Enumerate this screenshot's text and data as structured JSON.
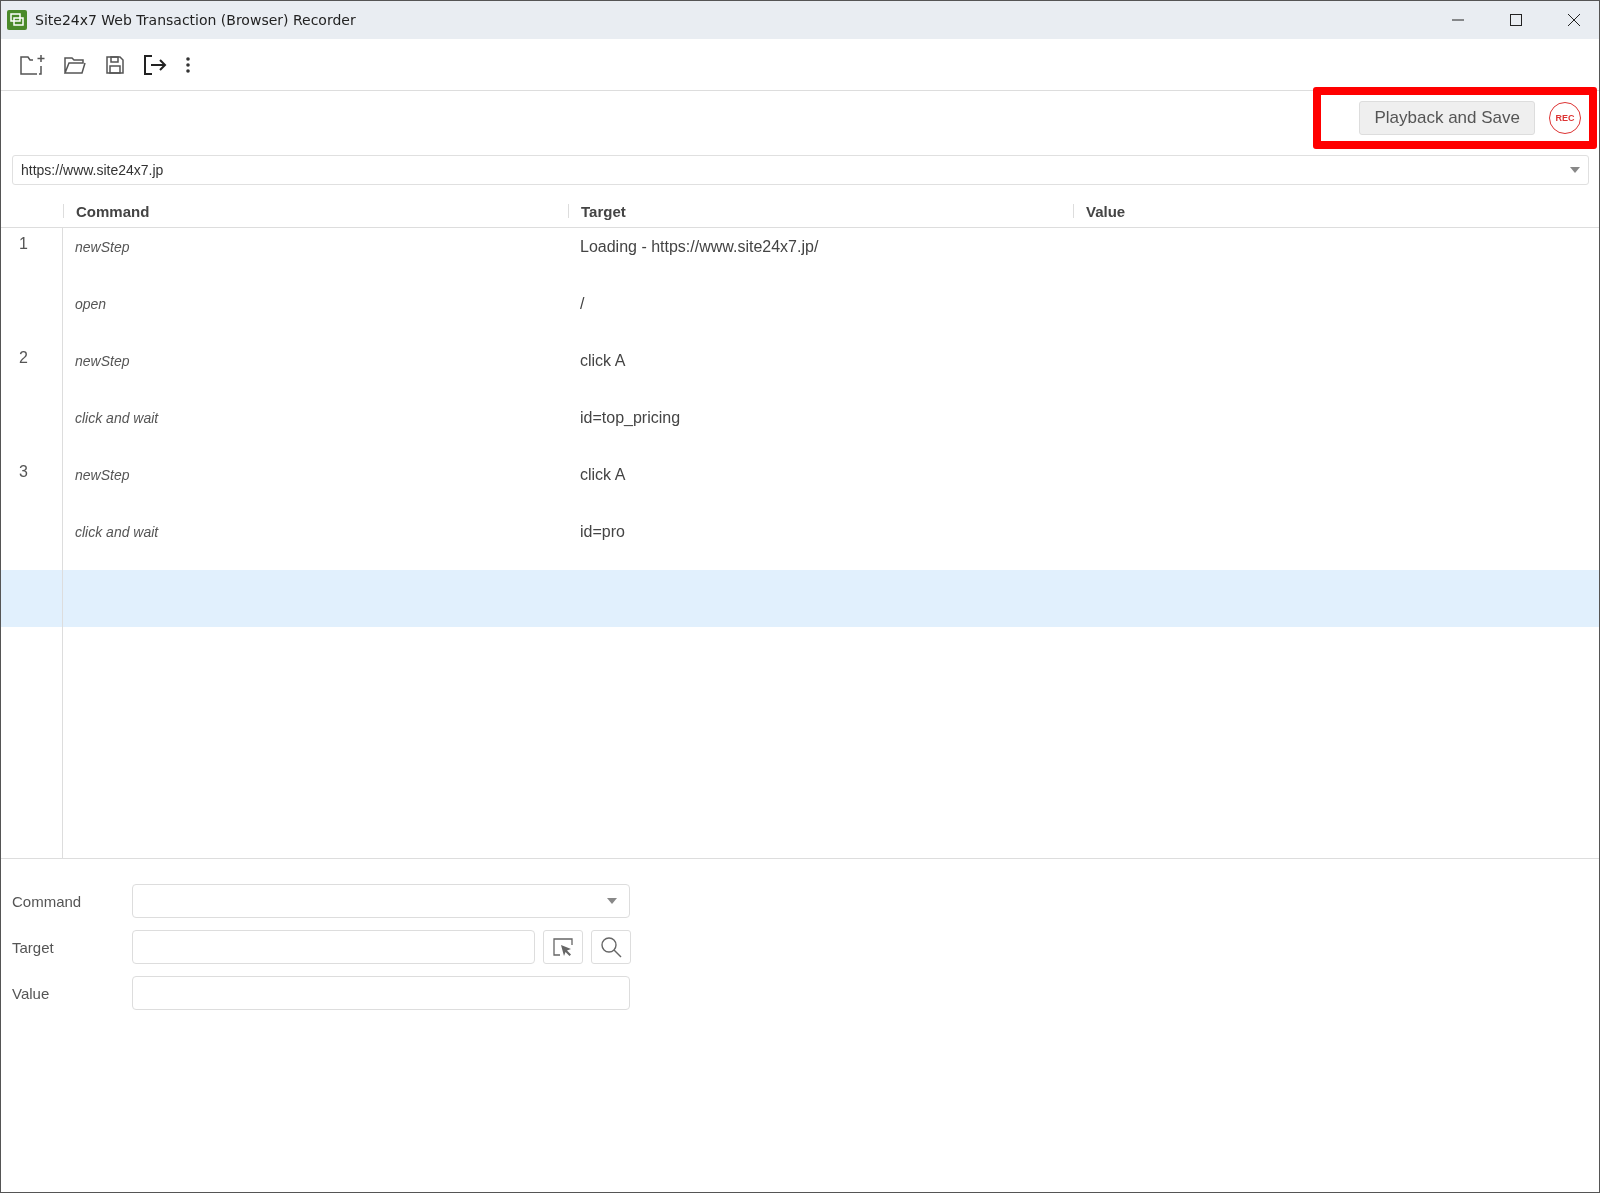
{
  "window": {
    "title": "Site24x7 Web Transaction (Browser) Recorder"
  },
  "actions": {
    "playback_button": "Playback and Save",
    "record_button": "REC",
    "annotation": {
      "kind": "frame"
    }
  },
  "url_field": {
    "value": "https://www.site24x7.jp"
  },
  "table": {
    "columns": [
      "Command",
      "Target",
      "Value"
    ],
    "steps": [
      {
        "number": "1",
        "commands": [
          {
            "command": "newStep",
            "target": "Loading - https://www.site24x7.jp/",
            "selected": false
          },
          {
            "command": "open",
            "target": "/",
            "selected": false
          }
        ]
      },
      {
        "number": "2",
        "commands": [
          {
            "command": "newStep",
            "target": "click A",
            "selected": false
          },
          {
            "command": "click and wait",
            "target": "id=top_pricing",
            "selected": false
          }
        ]
      },
      {
        "number": "3",
        "commands": [
          {
            "command": "newStep",
            "target": "click A",
            "selected": false
          },
          {
            "command": "click and wait",
            "target": "id=pro",
            "selected": false
          }
        ]
      }
    ],
    "new_row": {
      "selected": true
    }
  },
  "editor": {
    "command_label": "Command",
    "target_label": "Target",
    "value_label": "Value"
  }
}
